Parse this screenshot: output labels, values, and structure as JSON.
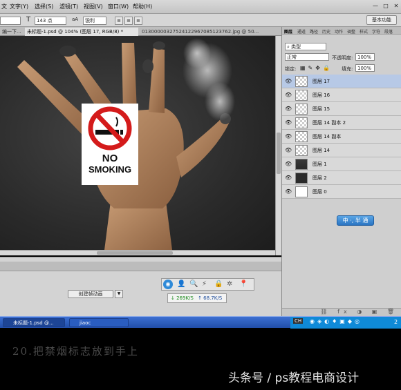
{
  "menubar": {
    "items": [
      "文字(Y)",
      "选择(S)",
      "滤镜(T)",
      "视图(V)",
      "窗口(W)",
      "帮助(H)"
    ],
    "window_controls": [
      "—",
      "□",
      "✕"
    ]
  },
  "options": {
    "font_size": "143 点",
    "aa_icon": "aA",
    "antialias": "锐利",
    "workspace_button": "基本功能"
  },
  "tabs": [
    {
      "label": "编一下...",
      "active": false
    },
    {
      "label": "未标题-1.psd @ 104% (图层 17, RGB/8) *",
      "active": true
    },
    {
      "label": "01300000327524122967085123762.jpg @ 50...",
      "active": false
    }
  ],
  "sign": {
    "line1": "NO",
    "line2": "SMOKING"
  },
  "animation": {
    "create_label": "创建帧动画",
    "dropdown_icon": "▼"
  },
  "speed": {
    "down": "↓ 269K/S",
    "up": "↑ 68.7K/S"
  },
  "layers_panel": {
    "tabs": [
      "图层",
      "通道",
      "路径",
      "历史",
      "动作",
      "调整",
      "样式",
      "字符",
      "段落"
    ],
    "filter_label": "类型",
    "blend_mode": "正常",
    "opacity_label": "不透明度:",
    "opacity_value": "100%",
    "lock_label": "锁定:",
    "fill_label": "填充:",
    "fill_value": "100%",
    "layers": [
      {
        "name": "图层 17",
        "selected": true,
        "thumb": "checker"
      },
      {
        "name": "图层 16",
        "selected": false,
        "thumb": "checker"
      },
      {
        "name": "图层 15",
        "selected": false,
        "thumb": "checker"
      },
      {
        "name": "图层 14 副本 2",
        "selected": false,
        "thumb": "checker"
      },
      {
        "name": "图层 14 副本",
        "selected": false,
        "thumb": "checker"
      },
      {
        "name": "图层 14",
        "selected": false,
        "thumb": "checker"
      },
      {
        "name": "图层 1",
        "selected": false,
        "thumb": "hand"
      },
      {
        "name": "图层 2",
        "selected": false,
        "thumb": "dark"
      },
      {
        "name": "图层 0",
        "selected": false,
        "thumb": "white"
      }
    ]
  },
  "badge": "中 ·, 半 通",
  "taskbar": {
    "items": [
      "未标题-1.psd @...",
      "jiaoc"
    ],
    "tray_text": "CH",
    "clock": "2"
  },
  "caption": "20.把禁烟标志放到手上",
  "watermark": "头条号 / ps教程电商设计"
}
